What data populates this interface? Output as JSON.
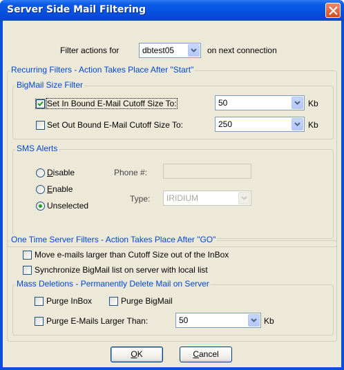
{
  "window": {
    "title": "Server Side Mail Filtering"
  },
  "filter_actions": {
    "prefix": "Filter actions for",
    "account": "dbtest05",
    "suffix": "on next connection"
  },
  "recurring": {
    "legend": "Recurring Filters - Action Takes Place After \"Start\"",
    "bigmail": {
      "legend": "BigMail Size Filter",
      "inbound": {
        "label": "Set In Bound E-Mail Cutoff Size To:",
        "checked": true,
        "value": "50",
        "unit": "Kb"
      },
      "outbound": {
        "label": "Set Out Bound E-Mail Cutoff Size To:",
        "checked": false,
        "value": "250",
        "unit": "Kb"
      }
    },
    "sms": {
      "legend": "SMS Alerts",
      "options": [
        {
          "pre": "",
          "accel": "D",
          "post": "isable",
          "selected": false
        },
        {
          "pre": "",
          "accel": "E",
          "post": "nable",
          "selected": false
        },
        {
          "pre": "Unselected",
          "accel": "",
          "post": "",
          "selected": true
        }
      ],
      "phone_label": "Phone #:",
      "phone_value": "",
      "type_label": "Type:",
      "type_value": "IRIDIUM"
    }
  },
  "onetime": {
    "legend": "One Time Server Filters  - Action Takes Place After \"GO\"",
    "move_label": "Move e-mails larger than Cutoff Size out of the InBox",
    "sync_label": "Synchronize BigMail list on server with local list",
    "mass": {
      "legend": "Mass Deletions - Permanently Delete Mail on Server",
      "purge_inbox": "Purge InBox",
      "purge_bigmail": "Purge BigMail",
      "purge_larger": "Purge E-Mails Larger Than:",
      "purge_value": "50",
      "unit": "Kb"
    }
  },
  "buttons": {
    "ok": {
      "accel": "O",
      "rest": "K"
    },
    "cancel": {
      "accel": "C",
      "rest": "ancel"
    }
  },
  "colors": {
    "titlebar": "#0650e0",
    "dialog_bg": "#ece9d8",
    "legend_text": "#0046d5",
    "close": "#d64a1e"
  }
}
